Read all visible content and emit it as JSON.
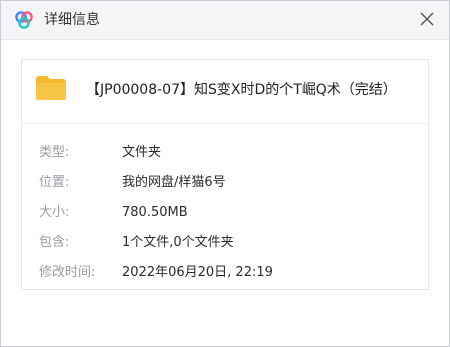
{
  "window": {
    "title": "详细信息"
  },
  "file": {
    "name": "【JP00008-07】知S变X时D的个T崛Q术（完结）"
  },
  "details": [
    {
      "label": "类型:",
      "value": "文件夹"
    },
    {
      "label": "位置:",
      "value": "我的网盘/样猫6号"
    },
    {
      "label": "大小:",
      "value": "780.50MB"
    },
    {
      "label": "包含:",
      "value": "1个文件,0个文件夹"
    },
    {
      "label": "修改时间:",
      "value": "2022年06月20日, 22:19"
    }
  ],
  "icons": {
    "app": "baidu-netdisk-logo",
    "close": "close-icon",
    "folder": "folder-icon"
  },
  "colors": {
    "folder": "#f7c544",
    "logo_blue": "#3f86f5",
    "logo_pink": "#f5568b",
    "logo_teal": "#23c8c5"
  }
}
